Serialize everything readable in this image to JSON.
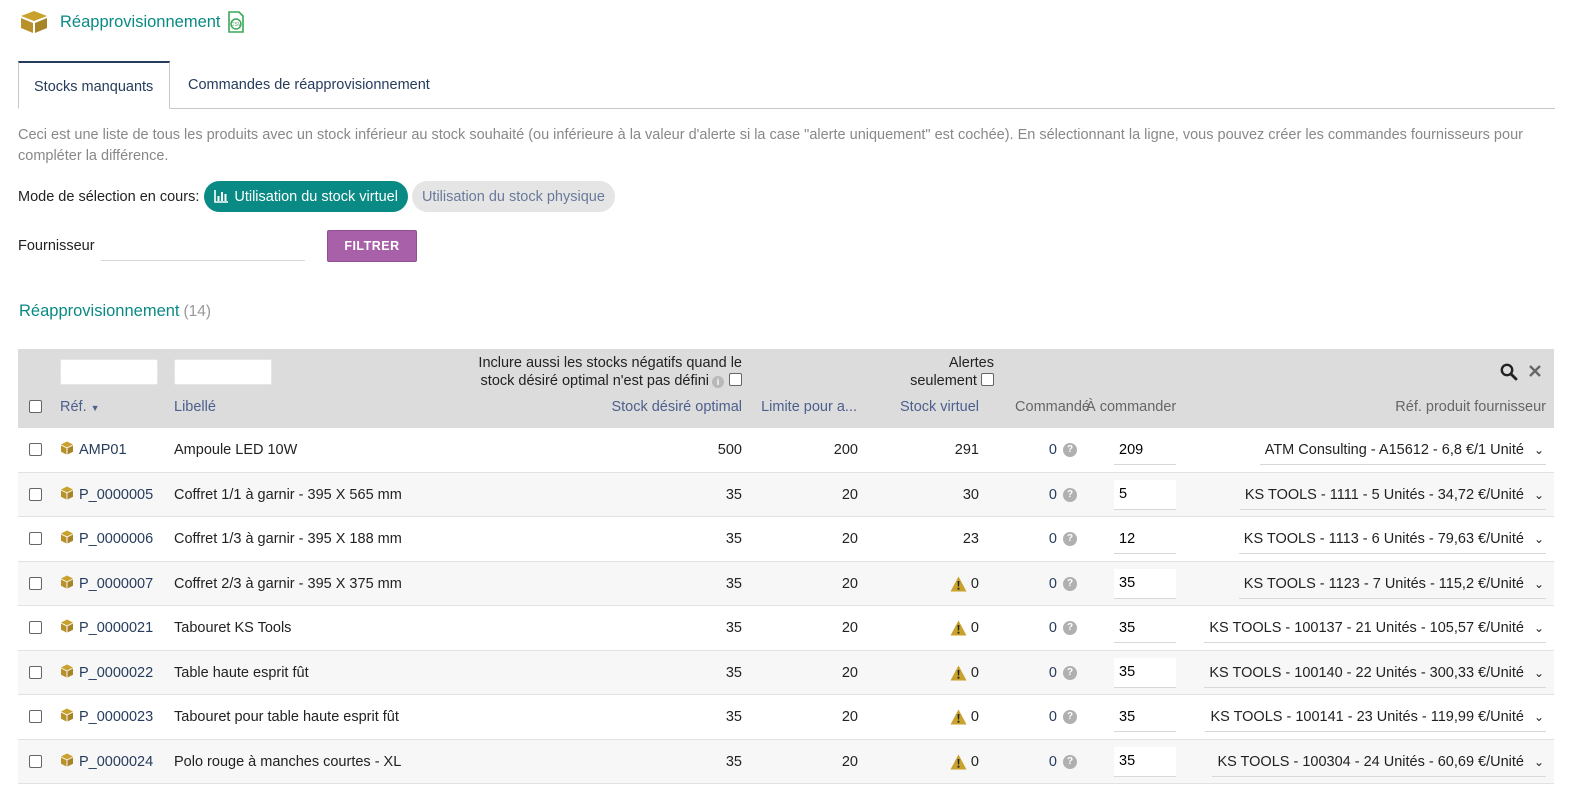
{
  "page": {
    "title": "Réapprovisionnement"
  },
  "tabs": [
    {
      "label": "Stocks manquants"
    },
    {
      "label": "Commandes de réapprovisionnement"
    }
  ],
  "description": "Ceci est une liste de tous les produits avec un stock inférieur au stock souhaité (ou inférieure à la valeur d'alerte si la case \"alerte uniquement\" est cochée). En sélectionnant la ligne, vous pouvez créer les commandes fournisseurs pour compléter la différence.",
  "mode": {
    "label": "Mode de sélection en cours:",
    "virtual": "Utilisation du stock virtuel",
    "physical": "Utilisation du stock physique"
  },
  "filter": {
    "supplier_label": "Fournisseur",
    "supplier_value": "",
    "button": "FILTRER"
  },
  "section": {
    "title": "Réapprovisionnement",
    "count": "(14)"
  },
  "table": {
    "include_negative": "Inclure aussi les stocks négatifs quand le stock désiré optimal n'est pas défini",
    "alerts_only_line1": "Alertes",
    "alerts_only_line2": "seulement",
    "headers": {
      "ref": "Réf.",
      "label": "Libellé",
      "desired_stock": "Stock désiré optimal",
      "limit": "Limite pour a...",
      "virtual_stock": "Stock virtuel",
      "ordered": "Commandé",
      "to_order": "À commander",
      "supplier_ref": "Réf. produit fournisseur"
    },
    "rows": [
      {
        "ref": "AMP01",
        "label": "Ampoule LED 10W",
        "desired": "500",
        "limit": "200",
        "virtual": "291",
        "warn": false,
        "ordered": "0",
        "to_order": "209",
        "supplier": "ATM Consulting - A15612 - 6,8 €/1 Unité"
      },
      {
        "ref": "P_0000005",
        "label": "Coffret 1/1 à garnir - 395 X 565 mm",
        "desired": "35",
        "limit": "20",
        "virtual": "30",
        "warn": false,
        "ordered": "0",
        "to_order": "5",
        "supplier": "KS TOOLS - 1111 - 5 Unités - 34,72 €/Unité"
      },
      {
        "ref": "P_0000006",
        "label": "Coffret 1/3 à garnir - 395 X 188 mm",
        "desired": "35",
        "limit": "20",
        "virtual": "23",
        "warn": false,
        "ordered": "0",
        "to_order": "12",
        "supplier": "KS TOOLS - 1113 - 6 Unités - 79,63 €/Unité"
      },
      {
        "ref": "P_0000007",
        "label": "Coffret 2/3 à garnir - 395 X 375 mm",
        "desired": "35",
        "limit": "20",
        "virtual": "0",
        "warn": true,
        "ordered": "0",
        "to_order": "35",
        "supplier": "KS TOOLS - 1123 - 7 Unités - 115,2 €/Unité"
      },
      {
        "ref": "P_0000021",
        "label": "Tabouret KS Tools",
        "desired": "35",
        "limit": "20",
        "virtual": "0",
        "warn": true,
        "ordered": "0",
        "to_order": "35",
        "supplier": "KS TOOLS - 100137 - 21 Unités - 105,57 €/Unité"
      },
      {
        "ref": "P_0000022",
        "label": "Table haute esprit fût",
        "desired": "35",
        "limit": "20",
        "virtual": "0",
        "warn": true,
        "ordered": "0",
        "to_order": "35",
        "supplier": "KS TOOLS - 100140 - 22 Unités - 300,33 €/Unité"
      },
      {
        "ref": "P_0000023",
        "label": "Tabouret pour table haute esprit fût",
        "desired": "35",
        "limit": "20",
        "virtual": "0",
        "warn": true,
        "ordered": "0",
        "to_order": "35",
        "supplier": "KS TOOLS - 100141 - 23 Unités - 119,99 €/Unité"
      },
      {
        "ref": "P_0000024",
        "label": "Polo rouge à manches courtes - XL",
        "desired": "35",
        "limit": "20",
        "virtual": "0",
        "warn": true,
        "ordered": "0",
        "to_order": "35",
        "supplier": "KS TOOLS - 100304 - 24 Unités - 60,69 €/Unité"
      }
    ]
  },
  "colors": {
    "accent": "#0a8a84",
    "button": "#a861a9",
    "link": "#263c5c",
    "warning": "#c8a22c"
  }
}
